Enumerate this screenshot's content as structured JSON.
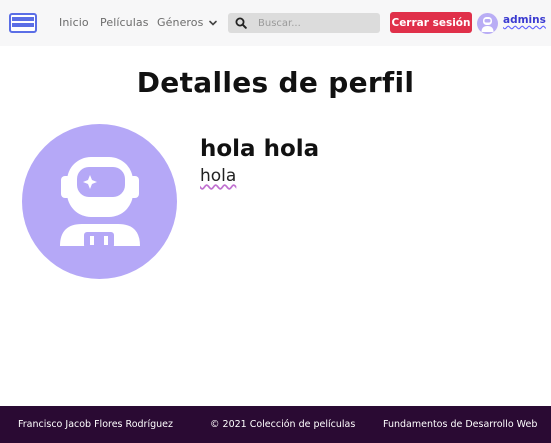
{
  "navbar": {
    "brand_icon": "film-strip-icon",
    "links": {
      "inicio": "Inicio",
      "peliculas": "Películas",
      "generos": "Géneros"
    },
    "search": {
      "placeholder": "Buscar...",
      "value": ""
    },
    "logout_label": "Cerrar sesión",
    "username": "admins",
    "colors": {
      "logout": "#e0304a",
      "brand": "#5b6ee6",
      "avatar": "#b9adf5"
    }
  },
  "main": {
    "title": "Detalles de perfil",
    "profile": {
      "name": "hola hola",
      "description": "hola",
      "avatar_icon": "astronaut-icon",
      "avatar_color": "#b5a8f7"
    }
  },
  "footer": {
    "author": "Francisco Jacob Flores Rodríguez",
    "copyright": "© 2021 Colección de películas",
    "course": "Fundamentos de Desarrollo Web",
    "background": "#2a0a33"
  }
}
